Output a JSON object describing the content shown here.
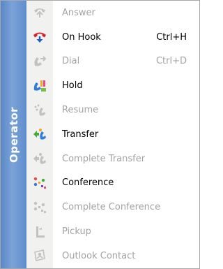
{
  "menu": {
    "side_label": "Operator",
    "colors": {
      "band": "#6f9ad4",
      "disabled_text": "#a3a3a3",
      "enabled_text": "#000000"
    },
    "items": [
      {
        "label": "Answer",
        "shortcut": "",
        "enabled": false,
        "icon": "phone-answer-icon"
      },
      {
        "label": "On Hook",
        "shortcut": "Ctrl+H",
        "enabled": true,
        "icon": "phone-hangup-icon"
      },
      {
        "label": "Dial",
        "shortcut": "Ctrl+D",
        "enabled": false,
        "icon": "phone-dial-icon"
      },
      {
        "label": "Hold",
        "shortcut": "",
        "enabled": true,
        "icon": "hold-icon"
      },
      {
        "label": "Resume",
        "shortcut": "",
        "enabled": false,
        "icon": "resume-icon"
      },
      {
        "label": "Transfer",
        "shortcut": "",
        "enabled": true,
        "icon": "transfer-icon"
      },
      {
        "label": "Complete Transfer",
        "shortcut": "",
        "enabled": false,
        "icon": "complete-transfer-icon"
      },
      {
        "label": "Conference",
        "shortcut": "",
        "enabled": true,
        "icon": "conference-icon"
      },
      {
        "label": "Complete Conference",
        "shortcut": "",
        "enabled": false,
        "icon": "complete-conference-icon"
      },
      {
        "label": "Pickup",
        "shortcut": "",
        "enabled": false,
        "icon": "pickup-icon"
      },
      {
        "label": "Outlook Contact",
        "shortcut": "",
        "enabled": false,
        "icon": "outlook-contact-icon"
      }
    ]
  }
}
